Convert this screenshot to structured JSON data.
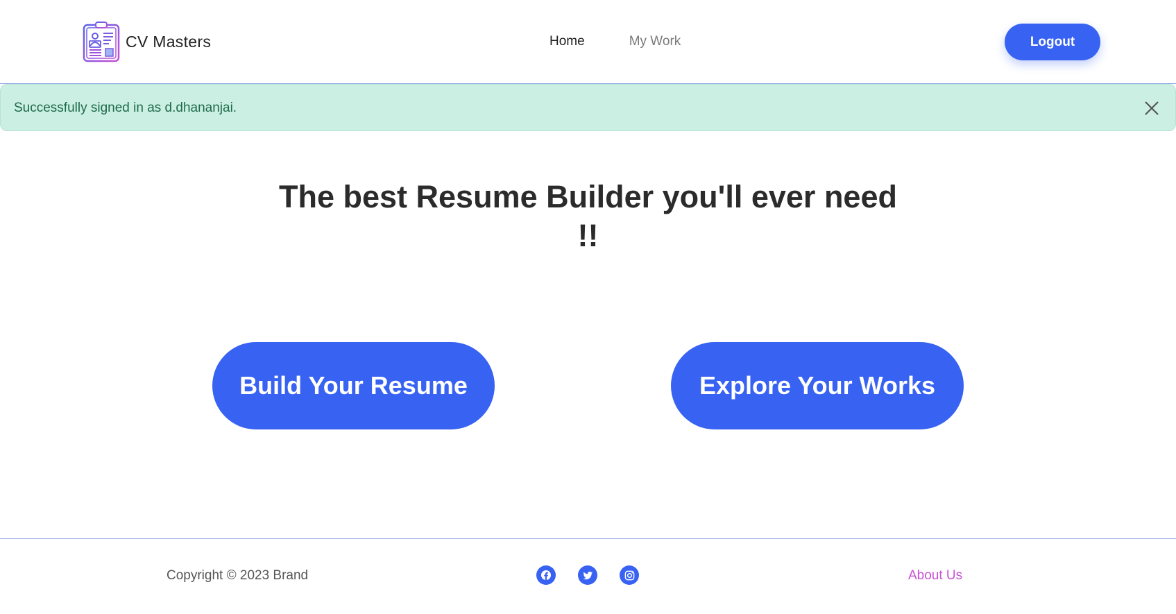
{
  "header": {
    "brand_name": "CV Masters",
    "logo_icon": "resume-clipboard-icon",
    "nav": [
      {
        "label": "Home",
        "active": true
      },
      {
        "label": "My Work",
        "active": false
      }
    ],
    "logout_label": "Logout"
  },
  "alert": {
    "message": "Successfully signed in as d.dhananjai.",
    "close_icon": "close-icon",
    "background": "#ccefe3",
    "text_color": "#1c6a4c"
  },
  "hero": {
    "title": "The best Resume Builder you'll ever need !!",
    "build_label": "Build Your Resume",
    "explore_label": "Explore Your Works"
  },
  "footer": {
    "copyright": "Copyright © 2023 Brand",
    "socials": [
      "facebook-icon",
      "twitter-icon",
      "instagram-icon"
    ],
    "about_label": "About Us"
  },
  "colors": {
    "accent": "#3762f2",
    "about_link": "#c94fd6",
    "divider": "#8fa6e6"
  }
}
